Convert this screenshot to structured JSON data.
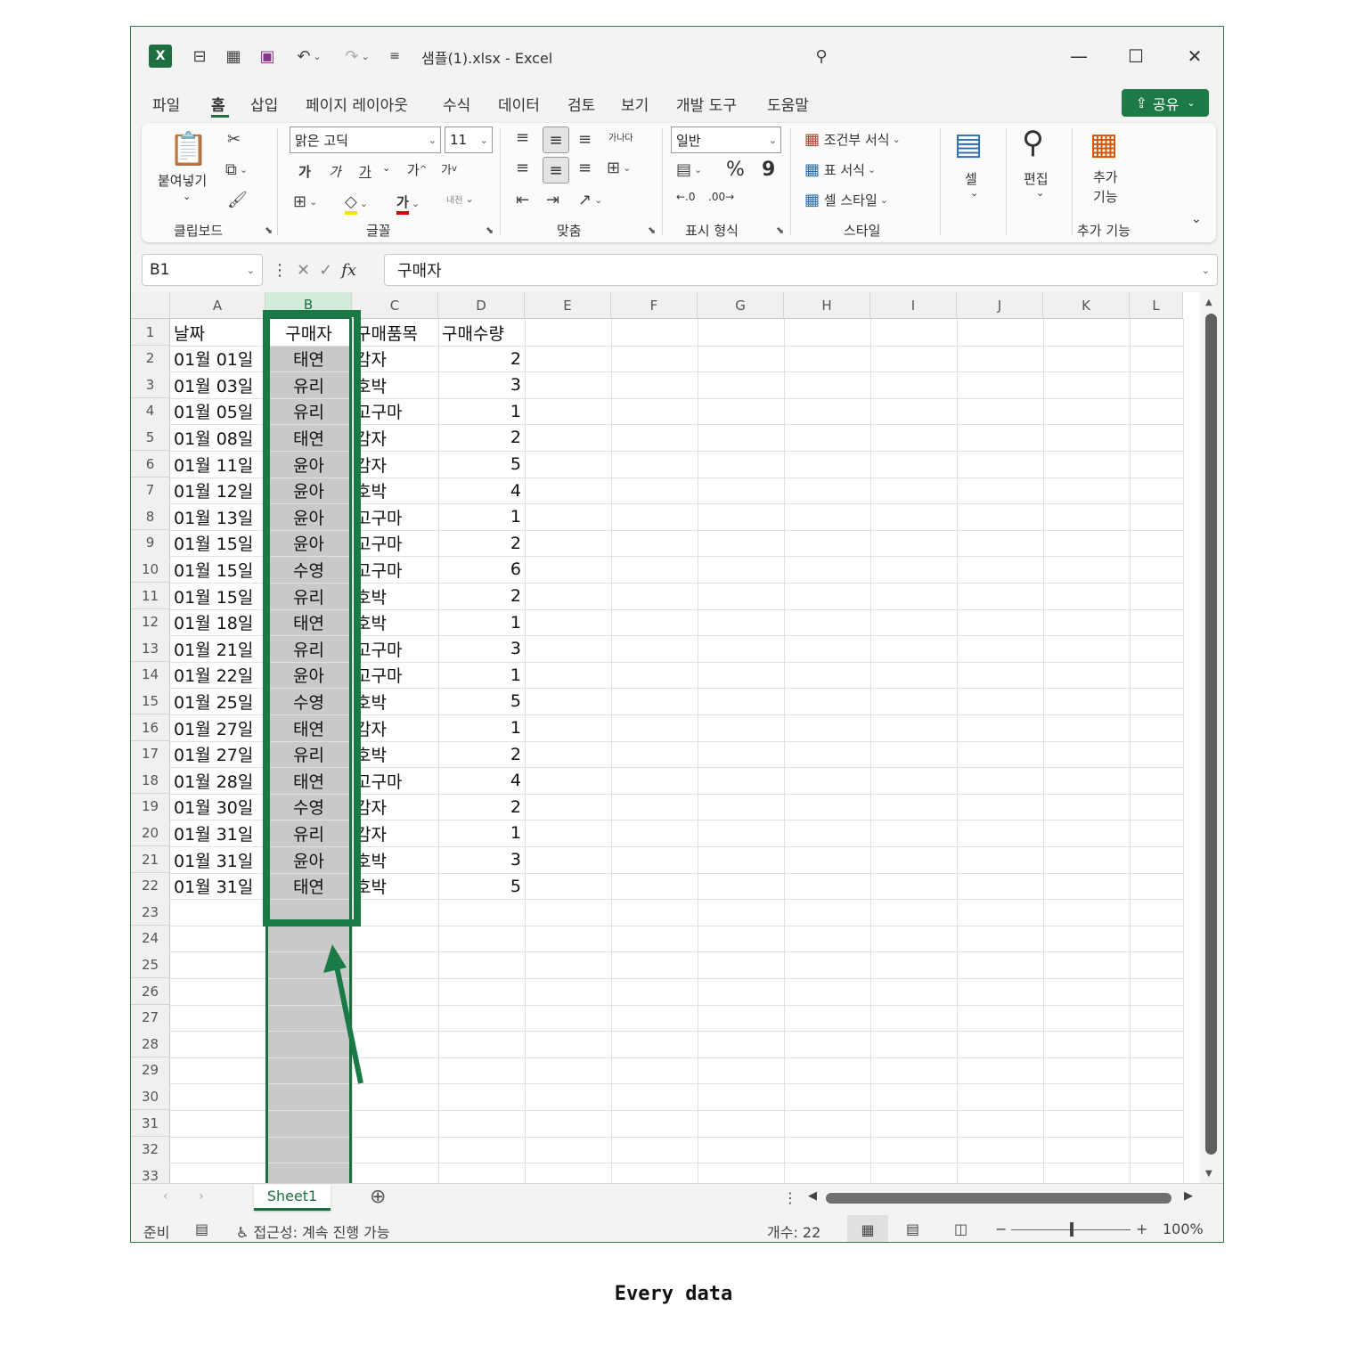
{
  "window": {
    "title": "샘플(1).xlsx  -  Excel",
    "accent_color": "#1d6f42"
  },
  "menu": {
    "tabs": [
      "파일",
      "홈",
      "삽입",
      "페이지 레이아웃",
      "수식",
      "데이터",
      "검토",
      "보기",
      "개발 도구",
      "도움말"
    ],
    "active_tab": "홈",
    "share_label": "공유"
  },
  "ribbon": {
    "clipboard": {
      "paste_label": "붙여넣기",
      "group_label": "클립보드"
    },
    "font": {
      "font_name": "맑은 고딕",
      "font_size": "11",
      "group_label": "글꼴",
      "bold": "가",
      "italic": "가",
      "underline": "가",
      "grow": "가",
      "shrink": "가",
      "color_sample": "가",
      "phonetic": "내천"
    },
    "alignment": {
      "group_label": "맞춤",
      "wrap": "가나다"
    },
    "number": {
      "format": "일반",
      "group_label": "표시 형식",
      "percent": "%",
      "comma": "9"
    },
    "styles": {
      "conditional": "조건부 서식",
      "table": "표 서식",
      "cell_style": "셀 스타일",
      "group_label": "스타일"
    },
    "cells": {
      "label": "셀"
    },
    "editing": {
      "label": "편집"
    },
    "addins": {
      "label": "추가\n기능",
      "group_label": "추가 기능"
    }
  },
  "formula_bar": {
    "name_box": "B1",
    "fx": "fx",
    "content": "구매자"
  },
  "sheet": {
    "columns": [
      "A",
      "B",
      "C",
      "D",
      "E",
      "F",
      "G",
      "H",
      "I",
      "J",
      "K",
      "L"
    ],
    "selected_column": "B",
    "header_row": [
      "날짜",
      "구매자",
      "구매품목",
      "구매수량"
    ],
    "rows": [
      [
        "01월 01일",
        "태연",
        "감자",
        "2"
      ],
      [
        "01월 03일",
        "유리",
        "호박",
        "3"
      ],
      [
        "01월 05일",
        "유리",
        "고구마",
        "1"
      ],
      [
        "01월 08일",
        "태연",
        "감자",
        "2"
      ],
      [
        "01월 11일",
        "윤아",
        "감자",
        "5"
      ],
      [
        "01월 12일",
        "윤아",
        "호박",
        "4"
      ],
      [
        "01월 13일",
        "윤아",
        "고구마",
        "1"
      ],
      [
        "01월 15일",
        "윤아",
        "고구마",
        "2"
      ],
      [
        "01월 15일",
        "수영",
        "고구마",
        "6"
      ],
      [
        "01월 15일",
        "유리",
        "호박",
        "2"
      ],
      [
        "01월 18일",
        "태연",
        "호박",
        "1"
      ],
      [
        "01월 21일",
        "유리",
        "고구마",
        "3"
      ],
      [
        "01월 22일",
        "윤아",
        "고구마",
        "1"
      ],
      [
        "01월 25일",
        "수영",
        "호박",
        "5"
      ],
      [
        "01월 27일",
        "태연",
        "감자",
        "1"
      ],
      [
        "01월 27일",
        "유리",
        "호박",
        "2"
      ],
      [
        "01월 28일",
        "태연",
        "고구마",
        "4"
      ],
      [
        "01월 30일",
        "수영",
        "감자",
        "2"
      ],
      [
        "01월 31일",
        "유리",
        "감자",
        "1"
      ],
      [
        "01월 31일",
        "윤아",
        "호박",
        "3"
      ],
      [
        "01월 31일",
        "태연",
        "호박",
        "5"
      ]
    ],
    "row_numbers": [
      "1",
      "2",
      "3",
      "4",
      "5",
      "6",
      "7",
      "8",
      "9",
      "10",
      "11",
      "12",
      "13",
      "14",
      "15",
      "16",
      "17",
      "18",
      "19",
      "20",
      "21",
      "22",
      "23",
      "24",
      "25",
      "26",
      "27",
      "28",
      "29",
      "30",
      "31",
      "32",
      "33"
    ],
    "tab_name": "Sheet1"
  },
  "status": {
    "ready": "준비",
    "accessibility": "접근성: 계속 진행 가능",
    "count": "개수: 22",
    "zoom": "100%"
  },
  "caption": "Every data"
}
